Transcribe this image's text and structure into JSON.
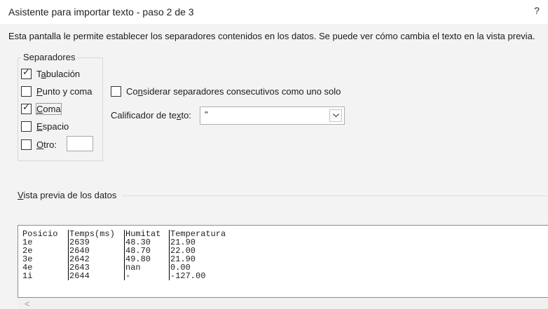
{
  "dialog": {
    "title": "Asistente para importar texto - paso 2 de 3",
    "help_label": "?",
    "description": "Esta pantalla le permite establecer los separadores contenidos en los datos. Se puede ver cómo cambia el texto en la vista previa."
  },
  "separators": {
    "group_title": "Separadores",
    "tab": {
      "label_pre": "T",
      "label_u": "a",
      "label_post": "bulación",
      "checked": true
    },
    "semicolon": {
      "label_pre": "",
      "label_u": "P",
      "label_post": "unto y coma",
      "checked": false
    },
    "comma": {
      "label_pre": "",
      "label_u": "C",
      "label_post": "oma",
      "checked": true
    },
    "space": {
      "label_pre": "",
      "label_u": "E",
      "label_post": "spacio",
      "checked": false
    },
    "other": {
      "label_pre": "",
      "label_u": "O",
      "label_post": "tro:",
      "checked": false,
      "value": ""
    }
  },
  "consecutive": {
    "label_pre": "Co",
    "label_u": "n",
    "label_post": "siderar separadores consecutivos como uno solo",
    "checked": false
  },
  "qualifier": {
    "label_pre": "Calificador de te",
    "label_u": "x",
    "label_post": "to:",
    "value": "\""
  },
  "preview": {
    "label_pre": "",
    "label_u": "V",
    "label_post": "ista previa de los datos",
    "columns": [
      "Posicio",
      "Temps(ms)",
      "Humitat",
      "Temperatura"
    ],
    "rows": [
      [
        "1e",
        "2639",
        "48.30",
        "21.90"
      ],
      [
        "2e",
        "2640",
        "48.70",
        "22.00"
      ],
      [
        "3e",
        "2642",
        "49.80",
        "21.90"
      ],
      [
        "4e",
        "2643",
        "nan",
        "0.00"
      ],
      [
        "1i",
        "2644",
        "-",
        "-127.00"
      ]
    ],
    "scroll_left_label": "<"
  }
}
